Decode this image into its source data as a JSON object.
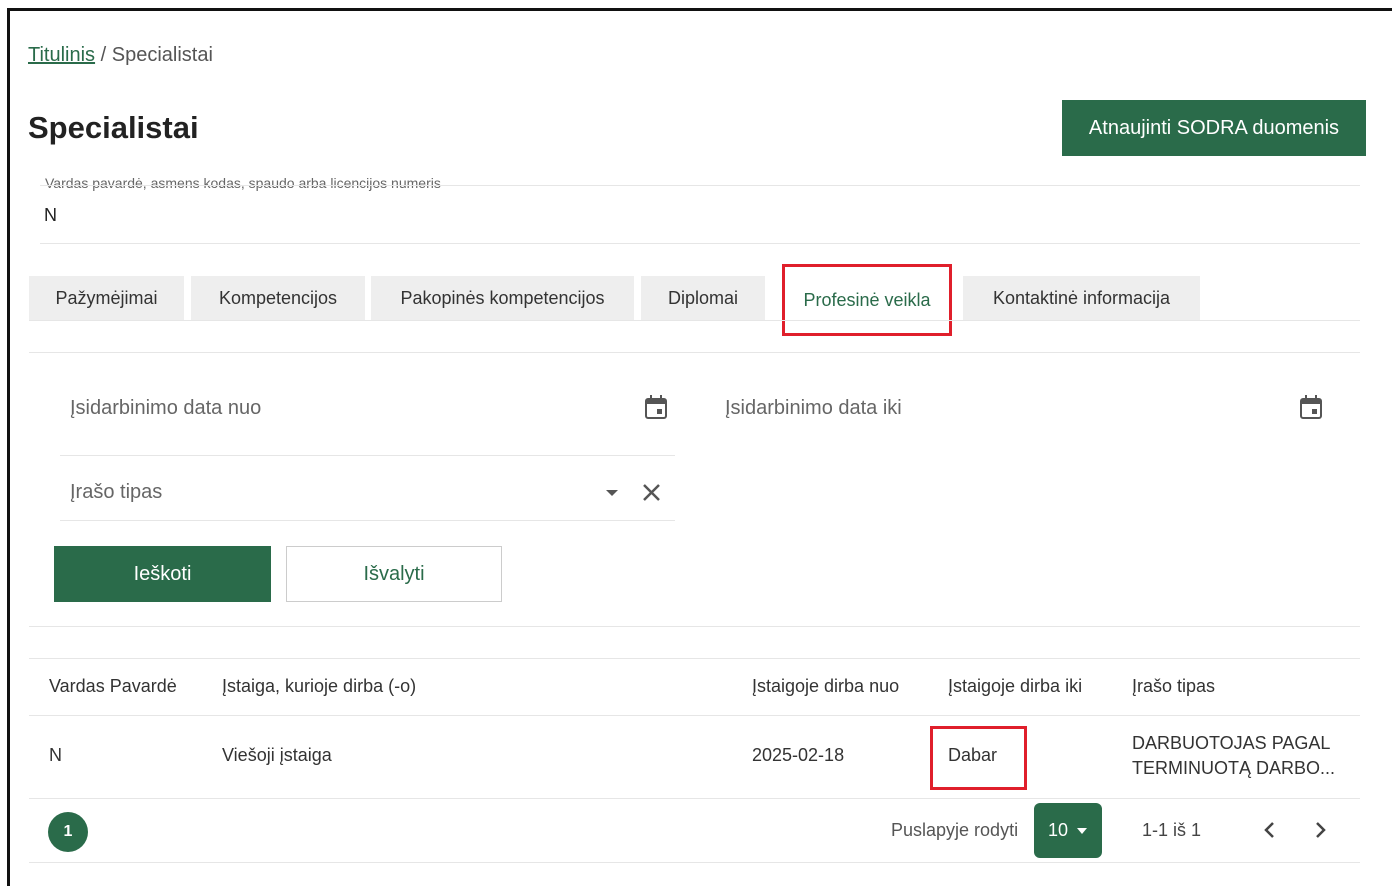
{
  "breadcrumb": {
    "home": "Titulinis",
    "separator": " / ",
    "current": "Specialistai"
  },
  "page": {
    "title": "Specialistai"
  },
  "header": {
    "sodra_button": "Atnaujinti SODRA duomenis"
  },
  "search": {
    "label": "Vardas pavardė, asmens kodas, spaudo arba licencijos numeris",
    "value": "N"
  },
  "tabs": [
    {
      "label": "Pažymėjimai",
      "active": false
    },
    {
      "label": "Kompetencijos",
      "active": false
    },
    {
      "label": "Pakopinės kompetencijos",
      "active": false
    },
    {
      "label": "Diplomai",
      "active": false
    },
    {
      "label": "Profesinė veikla",
      "active": true
    },
    {
      "label": "Kontaktinė informacija",
      "active": false
    }
  ],
  "filters": {
    "date_from": "Įsidarbinimo data nuo",
    "date_to": "Įsidarbinimo data iki",
    "record_type": "Įrašo tipas",
    "search_button": "Ieškoti",
    "clear_button": "Išvalyti"
  },
  "table": {
    "headers": [
      "Vardas Pavardė",
      "Įstaiga, kurioje dirba (-o)",
      "Įstaigoje dirba nuo",
      "Įstaigoje dirba iki",
      "Įrašo tipas"
    ],
    "rows": [
      {
        "name": "N",
        "institution": "Viešoji įstaiga",
        "from": "2025-02-18",
        "to": "Dabar",
        "type_line1": "DARBUOTOJAS PAGAL",
        "type_line2": "TERMINUOTĄ DARBO..."
      }
    ]
  },
  "pagination": {
    "current_page": "1",
    "per_page_label": "Puslapyje rodyti",
    "per_page": "10",
    "range": "1-1 iš 1"
  },
  "colors": {
    "accent": "#2a6b4a",
    "highlight": "#e01f2b"
  }
}
